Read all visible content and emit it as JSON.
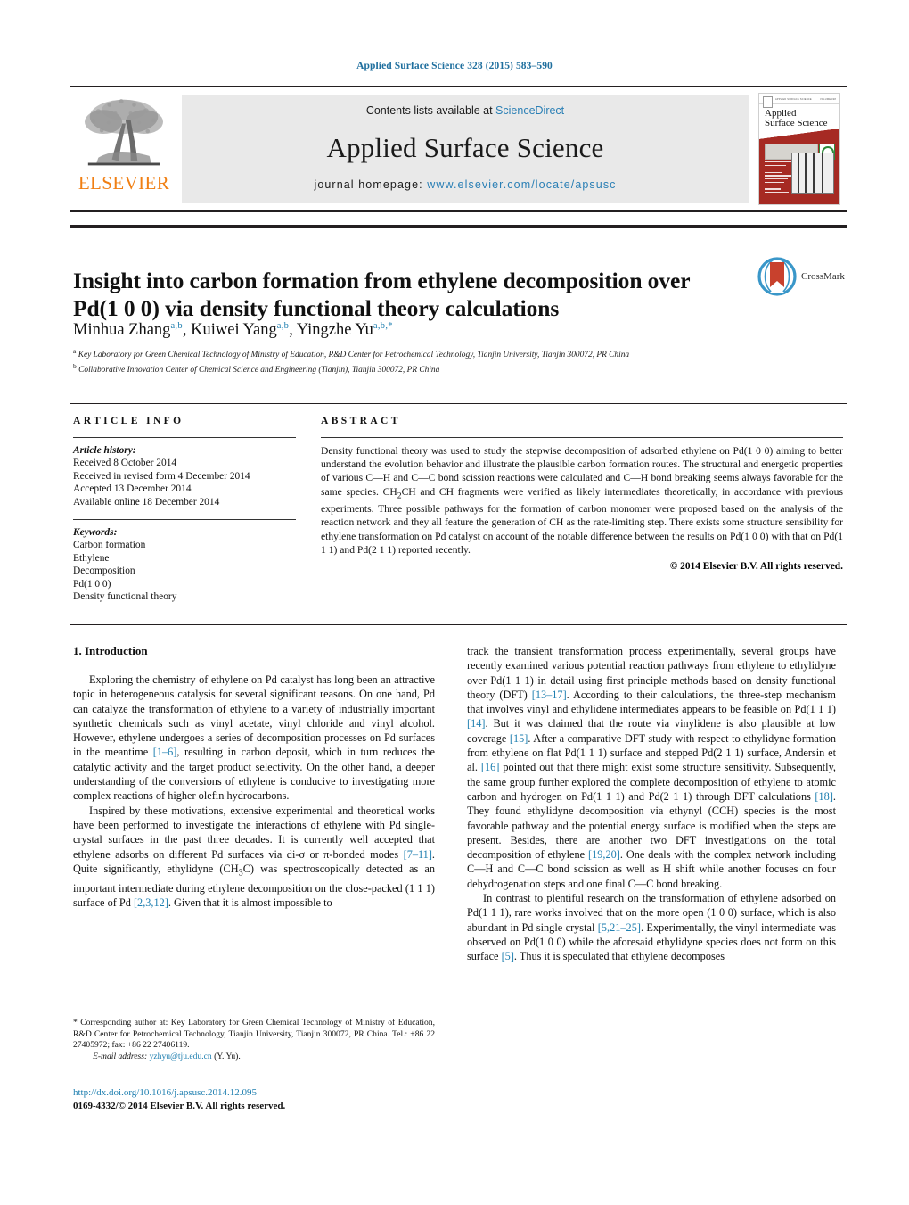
{
  "running_head": "Applied Surface Science 328 (2015) 583–590",
  "masthead": {
    "publisher": "ELSEVIER",
    "contents_prefix": "Contents lists available at ",
    "contents_link": "ScienceDirect",
    "journal_title": "Applied Surface Science",
    "homepage_prefix": "journal homepage: ",
    "homepage_url": "www.elsevier.com/locate/apsusc",
    "cover": {
      "title_line1": "Applied",
      "title_line2": "Surface Science"
    }
  },
  "article": {
    "title": "Insight into carbon formation from ethylene decomposition over Pd(1 0 0) via density functional theory calculations",
    "crossmark_label": "CrossMark",
    "authors_html": "Minhua Zhang<sup>a,b</sup>, Kuiwei Yang<sup>a,b</sup>, Yingzhe Yu<sup>a,b,*</sup>",
    "affiliation_a": "Key Laboratory for Green Chemical Technology of Ministry of Education, R&D Center for Petrochemical Technology, Tianjin University, Tianjin 300072, PR China",
    "affiliation_b": "Collaborative Innovation Center of Chemical Science and Engineering (Tianjin), Tianjin 300072, PR China"
  },
  "article_info": {
    "heading": "ARTICLE INFO",
    "history_label": "Article history:",
    "history": [
      "Received 8 October 2014",
      "Received in revised form 4 December 2014",
      "Accepted 13 December 2014",
      "Available online 18 December 2014"
    ],
    "keywords_label": "Keywords:",
    "keywords": [
      "Carbon formation",
      "Ethylene",
      "Decomposition",
      "Pd(1 0 0)",
      "Density functional theory"
    ]
  },
  "abstract": {
    "heading": "ABSTRACT",
    "text": "Density functional theory was used to study the stepwise decomposition of adsorbed ethylene on Pd(1 0 0) aiming to better understand the evolution behavior and illustrate the plausible carbon formation routes. The structural and energetic properties of various C—H and C—C bond scission reactions were calculated and C—H bond breaking seems always favorable for the same species. CH2CH and CH fragments were verified as likely intermediates theoretically, in accordance with previous experiments. Three possible pathways for the formation of carbon monomer were proposed based on the analysis of the reaction network and they all feature the generation of CH as the rate-limiting step. There exists some structure sensibility for ethylene transformation on Pd catalyst on account of the notable difference between the results on Pd(1 0 0) with that on Pd(1 1 1) and Pd(2 1 1) reported recently.",
    "copyright": "© 2014 Elsevier B.V. All rights reserved."
  },
  "body": {
    "section_title": "1.  Introduction",
    "left_paragraphs": [
      "Exploring the chemistry of ethylene on Pd catalyst has long been an attractive topic in heterogeneous catalysis for several significant reasons. On one hand, Pd can catalyze the transformation of ethylene to a variety of industrially important synthetic chemicals such as vinyl acetate, vinyl chloride and vinyl alcohol. However, ethylene undergoes a series of decomposition processes on Pd surfaces in the meantime [1–6], resulting in carbon deposit, which in turn reduces the catalytic activity and the target product selectivity. On the other hand, a deeper understanding of the conversions of ethylene is conducive to investigating more complex reactions of higher olefin hydrocarbons.",
      "Inspired by these motivations, extensive experimental and theoretical works have been performed to investigate the interactions of ethylene with Pd single-crystal surfaces in the past three decades. It is currently well accepted that ethylene adsorbs on different Pd surfaces via di-σ or π-bonded modes [7–11]. Quite significantly, ethylidyne (CH3C) was spectroscopically detected as an important intermediate during ethylene decomposition on the close-packed (1 1 1) surface of Pd [2,3,12]. Given that it is almost impossible to"
    ],
    "right_paragraphs": [
      "track the transient transformation process experimentally, several groups have recently examined various potential reaction pathways from ethylene to ethylidyne over Pd(1 1 1) in detail using first principle methods based on density functional theory (DFT) [13–17]. According to their calculations, the three-step mechanism that involves vinyl and ethylidene intermediates appears to be feasible on Pd(1 1 1) [14]. But it was claimed that the route via vinylidene is also plausible at low coverage [15]. After a comparative DFT study with respect to ethylidyne formation from ethylene on flat Pd(1 1 1) surface and stepped Pd(2 1 1) surface, Andersin et al. [16] pointed out that there might exist some structure sensitivity. Subsequently, the same group further explored the complete decomposition of ethylene to atomic carbon and hydrogen on Pd(1 1 1) and Pd(2 1 1) through DFT calculations [18]. They found ethylidyne decomposition via ethynyl (CCH) species is the most favorable pathway and the potential energy surface is modified when the steps are present. Besides, there are another two DFT investigations on the total decomposition of ethylene [19,20]. One deals with the complex network including C—H and C—C bond scission as well as H shift while another focuses on four dehydrogenation steps and one final C—C bond breaking.",
      "In contrast to plentiful research on the transformation of ethylene adsorbed on Pd(1 1 1), rare works involved that on the more open (1 0 0) surface, which is also abundant in Pd single crystal [5,21–25]. Experimentally, the vinyl intermediate was observed on Pd(1 0 0) while the aforesaid ethylidyne species does not form on this surface [5]. Thus it is speculated that ethylene decomposes"
    ]
  },
  "footnote": {
    "corresponding": "* Corresponding author at: Key Laboratory for Green Chemical Technology of Ministry of Education, R&D Center for Petrochemical Technology, Tianjin University, Tianjin 300072, PR China. Tel.: +86 22 27405972; fax: +86 22 27406119.",
    "email_label": "E-mail address:",
    "email": "yzhyu@tju.edu.cn",
    "email_owner": "(Y. Yu)."
  },
  "imprint": {
    "doi": "http://dx.doi.org/10.1016/j.apsusc.2014.12.095",
    "issn_line": "0169-4332/© 2014 Elsevier B.V. All rights reserved."
  },
  "colors": {
    "link": "#1f7fb0",
    "elsevier_orange": "#f07f13",
    "running_head": "#1f6f9e",
    "crossmark_red": "#c8412d",
    "crossmark_blue": "#3a97c9"
  }
}
